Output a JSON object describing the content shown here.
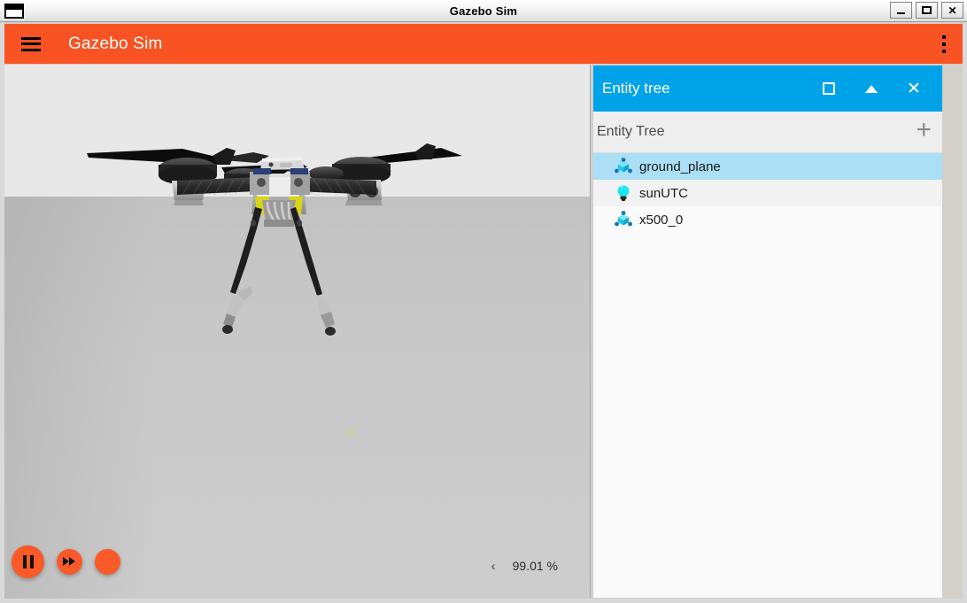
{
  "os_window": {
    "title": "Gazebo Sim",
    "icon": "window-icon",
    "buttons": [
      {
        "name": "minimize",
        "glyph": "_"
      },
      {
        "name": "maximize",
        "glyph": "□"
      },
      {
        "name": "close",
        "glyph": "✕"
      }
    ]
  },
  "toolbar": {
    "menu_icon": "hamburger-menu-icon",
    "title": "Gazebo Sim",
    "overflow_icon": "kebab-menu-icon",
    "background_color": "#f95323"
  },
  "viewport": {
    "scene_objects": [
      "x500 quadcopter drone",
      "ground plane"
    ],
    "sky_color": "#e8e8e8",
    "ground_color": "#c6c6c6"
  },
  "playback": {
    "buttons": [
      {
        "name": "pause-button",
        "icon": "pause-icon",
        "label": "Pause"
      },
      {
        "name": "step-button",
        "icon": "fast-forward-icon",
        "label": "Step"
      },
      {
        "name": "third-button",
        "icon": "partially-hidden-icon",
        "label": ""
      }
    ],
    "rtf_collapse_icon": "chevron-left-icon",
    "rtf_value": "99.01 %"
  },
  "entity_tree_dock": {
    "header": {
      "title": "Entity tree",
      "background_color": "#00a3e8",
      "buttons": [
        {
          "name": "float-button",
          "icon": "square-icon"
        },
        {
          "name": "collapse-button",
          "icon": "triangle-up-icon"
        },
        {
          "name": "close-button",
          "icon": "close-x-icon"
        }
      ]
    },
    "subheader": {
      "title": "Entity Tree",
      "add_icon": "plus-icon"
    },
    "items": [
      {
        "label": "ground_plane",
        "icon": "model-icon",
        "selected": true
      },
      {
        "label": "sunUTC",
        "icon": "light-bulb-icon",
        "selected": false
      },
      {
        "label": "x500_0",
        "icon": "model-icon",
        "selected": false
      }
    ],
    "selected_color": "#aadff5"
  }
}
